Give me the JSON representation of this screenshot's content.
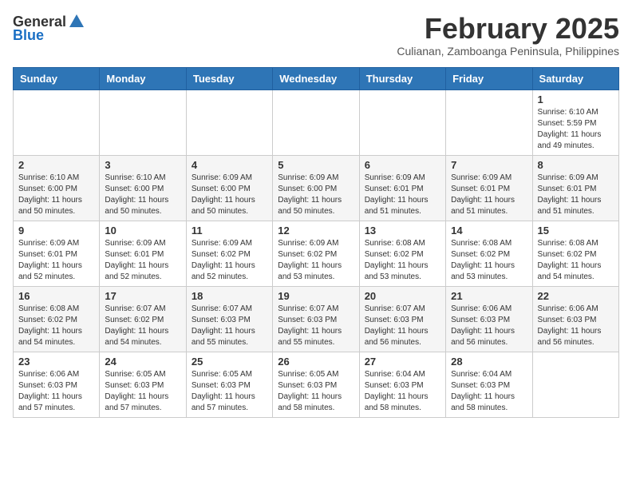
{
  "header": {
    "logo_general": "General",
    "logo_blue": "Blue",
    "month_title": "February 2025",
    "location": "Culianan, Zamboanga Peninsula, Philippines"
  },
  "weekdays": [
    "Sunday",
    "Monday",
    "Tuesday",
    "Wednesday",
    "Thursday",
    "Friday",
    "Saturday"
  ],
  "weeks": [
    [
      {
        "day": "",
        "info": ""
      },
      {
        "day": "",
        "info": ""
      },
      {
        "day": "",
        "info": ""
      },
      {
        "day": "",
        "info": ""
      },
      {
        "day": "",
        "info": ""
      },
      {
        "day": "",
        "info": ""
      },
      {
        "day": "1",
        "info": "Sunrise: 6:10 AM\nSunset: 5:59 PM\nDaylight: 11 hours and 49 minutes."
      }
    ],
    [
      {
        "day": "2",
        "info": "Sunrise: 6:10 AM\nSunset: 6:00 PM\nDaylight: 11 hours and 50 minutes."
      },
      {
        "day": "3",
        "info": "Sunrise: 6:10 AM\nSunset: 6:00 PM\nDaylight: 11 hours and 50 minutes."
      },
      {
        "day": "4",
        "info": "Sunrise: 6:09 AM\nSunset: 6:00 PM\nDaylight: 11 hours and 50 minutes."
      },
      {
        "day": "5",
        "info": "Sunrise: 6:09 AM\nSunset: 6:00 PM\nDaylight: 11 hours and 50 minutes."
      },
      {
        "day": "6",
        "info": "Sunrise: 6:09 AM\nSunset: 6:01 PM\nDaylight: 11 hours and 51 minutes."
      },
      {
        "day": "7",
        "info": "Sunrise: 6:09 AM\nSunset: 6:01 PM\nDaylight: 11 hours and 51 minutes."
      },
      {
        "day": "8",
        "info": "Sunrise: 6:09 AM\nSunset: 6:01 PM\nDaylight: 11 hours and 51 minutes."
      }
    ],
    [
      {
        "day": "9",
        "info": "Sunrise: 6:09 AM\nSunset: 6:01 PM\nDaylight: 11 hours and 52 minutes."
      },
      {
        "day": "10",
        "info": "Sunrise: 6:09 AM\nSunset: 6:01 PM\nDaylight: 11 hours and 52 minutes."
      },
      {
        "day": "11",
        "info": "Sunrise: 6:09 AM\nSunset: 6:02 PM\nDaylight: 11 hours and 52 minutes."
      },
      {
        "day": "12",
        "info": "Sunrise: 6:09 AM\nSunset: 6:02 PM\nDaylight: 11 hours and 53 minutes."
      },
      {
        "day": "13",
        "info": "Sunrise: 6:08 AM\nSunset: 6:02 PM\nDaylight: 11 hours and 53 minutes."
      },
      {
        "day": "14",
        "info": "Sunrise: 6:08 AM\nSunset: 6:02 PM\nDaylight: 11 hours and 53 minutes."
      },
      {
        "day": "15",
        "info": "Sunrise: 6:08 AM\nSunset: 6:02 PM\nDaylight: 11 hours and 54 minutes."
      }
    ],
    [
      {
        "day": "16",
        "info": "Sunrise: 6:08 AM\nSunset: 6:02 PM\nDaylight: 11 hours and 54 minutes."
      },
      {
        "day": "17",
        "info": "Sunrise: 6:07 AM\nSunset: 6:02 PM\nDaylight: 11 hours and 54 minutes."
      },
      {
        "day": "18",
        "info": "Sunrise: 6:07 AM\nSunset: 6:03 PM\nDaylight: 11 hours and 55 minutes."
      },
      {
        "day": "19",
        "info": "Sunrise: 6:07 AM\nSunset: 6:03 PM\nDaylight: 11 hours and 55 minutes."
      },
      {
        "day": "20",
        "info": "Sunrise: 6:07 AM\nSunset: 6:03 PM\nDaylight: 11 hours and 56 minutes."
      },
      {
        "day": "21",
        "info": "Sunrise: 6:06 AM\nSunset: 6:03 PM\nDaylight: 11 hours and 56 minutes."
      },
      {
        "day": "22",
        "info": "Sunrise: 6:06 AM\nSunset: 6:03 PM\nDaylight: 11 hours and 56 minutes."
      }
    ],
    [
      {
        "day": "23",
        "info": "Sunrise: 6:06 AM\nSunset: 6:03 PM\nDaylight: 11 hours and 57 minutes."
      },
      {
        "day": "24",
        "info": "Sunrise: 6:05 AM\nSunset: 6:03 PM\nDaylight: 11 hours and 57 minutes."
      },
      {
        "day": "25",
        "info": "Sunrise: 6:05 AM\nSunset: 6:03 PM\nDaylight: 11 hours and 57 minutes."
      },
      {
        "day": "26",
        "info": "Sunrise: 6:05 AM\nSunset: 6:03 PM\nDaylight: 11 hours and 58 minutes."
      },
      {
        "day": "27",
        "info": "Sunrise: 6:04 AM\nSunset: 6:03 PM\nDaylight: 11 hours and 58 minutes."
      },
      {
        "day": "28",
        "info": "Sunrise: 6:04 AM\nSunset: 6:03 PM\nDaylight: 11 hours and 58 minutes."
      },
      {
        "day": "",
        "info": ""
      }
    ]
  ]
}
